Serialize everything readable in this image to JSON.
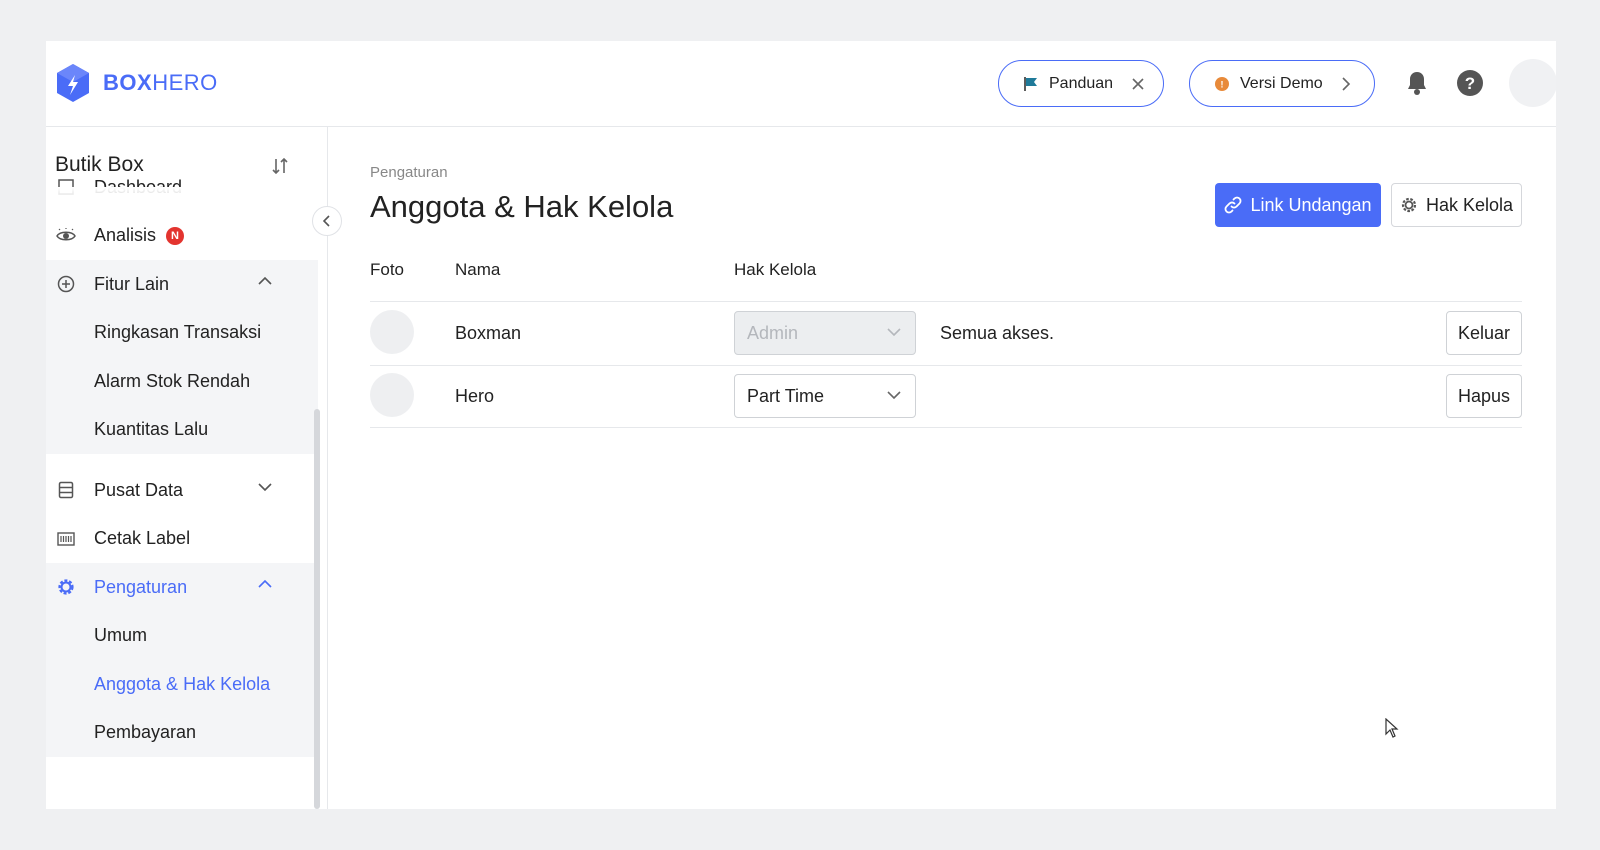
{
  "header": {
    "logo_text_bold": "BOX",
    "logo_text_light": "HERO",
    "guide_label": "Panduan",
    "demo_label": "Versi Demo",
    "colors": {
      "accent": "#4a6cf7",
      "badge": "#e3342f",
      "demo_coin": "#e88a3a",
      "flag": "#1f7a99"
    }
  },
  "sidebar": {
    "workspace_name": "Butik Box",
    "items": [
      {
        "label": "Dashboard",
        "icon": "dashboard-icon"
      },
      {
        "label": "Analisis",
        "icon": "eye-icon",
        "badge": "N"
      },
      {
        "label": "Fitur Lain",
        "icon": "plus-circle-icon",
        "expanded": true
      },
      {
        "label": "Ringkasan Transaksi",
        "sub": true
      },
      {
        "label": "Alarm Stok Rendah",
        "sub": true
      },
      {
        "label": "Kuantitas Lalu",
        "sub": true
      },
      {
        "label": "Pusat Data",
        "icon": "database-icon",
        "expanded": false
      },
      {
        "label": "Cetak Label",
        "icon": "barcode-icon"
      },
      {
        "label": "Pengaturan",
        "icon": "gear-icon",
        "expanded": true,
        "active": true
      },
      {
        "label": "Umum",
        "sub": true
      },
      {
        "label": "Anggota & Hak Kelola",
        "sub": true,
        "active": true
      },
      {
        "label": "Pembayaran",
        "sub": true
      }
    ]
  },
  "main": {
    "breadcrumb": "Pengaturan",
    "title": "Anggota & Hak Kelola",
    "invite_button": "Link Undangan",
    "permission_button": "Hak Kelola",
    "table": {
      "headers": [
        "Foto",
        "Nama",
        "Hak Kelola"
      ],
      "rows": [
        {
          "name": "Boxman",
          "role": "Admin",
          "role_disabled": true,
          "note": "Semua akses.",
          "action": "Keluar"
        },
        {
          "name": "Hero",
          "role": "Part Time",
          "role_disabled": false,
          "note": "",
          "action": "Hapus"
        }
      ]
    }
  }
}
